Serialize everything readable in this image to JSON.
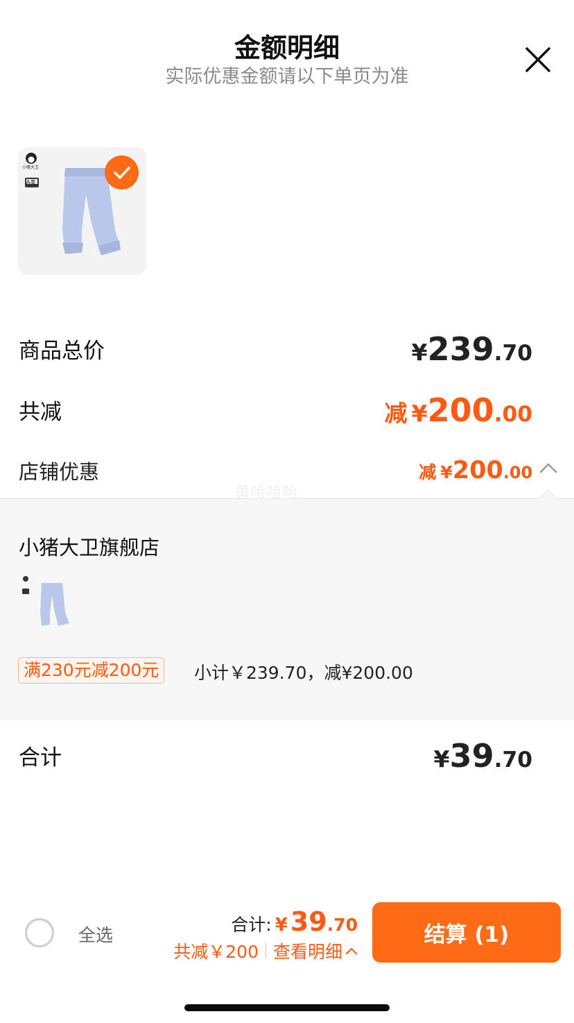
{
  "header": {
    "title": "金额明细",
    "subtitle": "实际优惠金额请以下单页为准",
    "close_icon": "close-icon"
  },
  "product": {
    "image_icon": "baby-pants-thumbnail",
    "brand_text": "小猪大卫",
    "grade_text": "A类",
    "selected_icon": "check-icon"
  },
  "summary": {
    "goods_total_label": "商品总价",
    "goods_total_currency": "¥",
    "goods_total_int": "239",
    "goods_total_dec": ".70",
    "discount_label": "共减",
    "discount_prefix": "减",
    "discount_currency": "¥",
    "discount_int": "200",
    "discount_dec": ".00",
    "store_discount_label": "店铺优惠",
    "store_discount_prefix": "减",
    "store_discount_currency": "¥",
    "store_discount_int": "200",
    "store_discount_dec": ".00",
    "chevron_icon": "chevron-up-icon"
  },
  "detail": {
    "store_name": "小猪大卫旗舰店",
    "promo_tag": "满230元减200元",
    "promo_text": "小计￥239.70，减¥200.00"
  },
  "total": {
    "label": "合计",
    "currency": "¥",
    "int": "39",
    "dec": ".70"
  },
  "watermark": "黄哈哈哈",
  "bottom_bar": {
    "select_all": "全选",
    "total_label": "合计:",
    "total_currency": "¥",
    "total_int": "39",
    "total_dec": ".70",
    "reduce_text": "共减￥200",
    "view_detail": "查看明细",
    "checkout_label": "结算 (1)"
  },
  "colors": {
    "accent": "#ff6a14",
    "discount_text": "#ff5a10",
    "panel_bg": "#f7f7f7"
  }
}
